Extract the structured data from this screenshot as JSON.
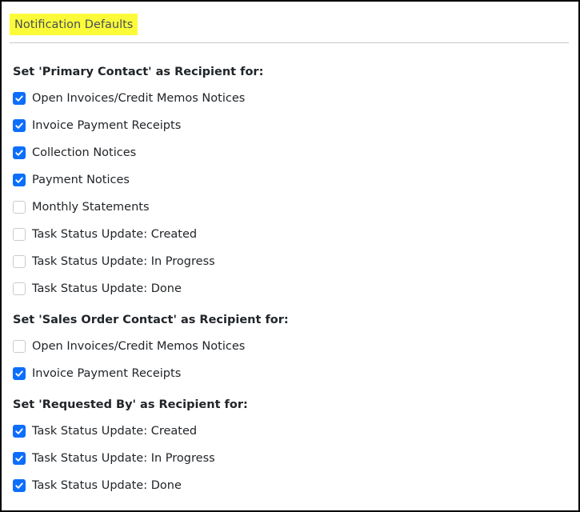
{
  "title": "Notification Defaults",
  "colors": {
    "highlight": "#fbfb3a",
    "checkbox_checked": "#0d6efd",
    "checkbox_unchecked_border": "#c8ccd0"
  },
  "sections": [
    {
      "heading": "Set 'Primary Contact' as Recipient for:",
      "items": [
        {
          "label": "Open Invoices/Credit Memos Notices",
          "checked": true
        },
        {
          "label": "Invoice Payment Receipts",
          "checked": true
        },
        {
          "label": "Collection Notices",
          "checked": true
        },
        {
          "label": "Payment Notices",
          "checked": true
        },
        {
          "label": "Monthly Statements",
          "checked": false
        },
        {
          "label": "Task Status Update: Created",
          "checked": false
        },
        {
          "label": "Task Status Update: In Progress",
          "checked": false
        },
        {
          "label": "Task Status Update: Done",
          "checked": false
        }
      ]
    },
    {
      "heading": "Set 'Sales Order Contact' as Recipient for:",
      "items": [
        {
          "label": "Open Invoices/Credit Memos Notices",
          "checked": false
        },
        {
          "label": "Invoice Payment Receipts",
          "checked": true
        }
      ]
    },
    {
      "heading": "Set 'Requested By' as Recipient for:",
      "items": [
        {
          "label": "Task Status Update: Created",
          "checked": true
        },
        {
          "label": "Task Status Update: In Progress",
          "checked": true
        },
        {
          "label": "Task Status Update: Done",
          "checked": true
        }
      ]
    }
  ]
}
